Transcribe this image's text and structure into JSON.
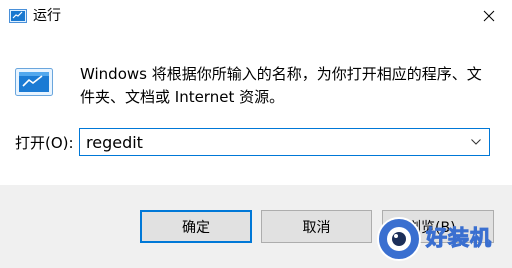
{
  "window": {
    "title": "运行",
    "close_icon": "close-icon"
  },
  "icons": {
    "title": "run-app-icon",
    "main": "run-app-icon"
  },
  "description": "Windows 将根据你所输入的名称，为你打开相应的程序、文件夹、文档或 Internet 资源。",
  "open_field": {
    "label": "打开(O):",
    "value": "regedit"
  },
  "buttons": {
    "ok": "确定",
    "cancel": "取消",
    "browse": "浏览(B)..."
  },
  "watermark": {
    "text": "好装机",
    "accent": "#3a6fd0"
  },
  "colors": {
    "focus": "#0078d7",
    "button_face": "#e1e1e1",
    "button_border": "#adadad"
  }
}
